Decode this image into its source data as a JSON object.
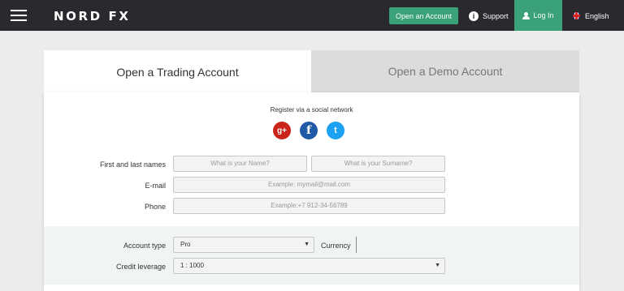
{
  "header": {
    "logo": "NORD FX",
    "open_account_label": "Open an Account",
    "support_label": "Support",
    "support_icon_glyph": "i",
    "login_label": "Log In",
    "language_label": "English"
  },
  "tabs": [
    {
      "label": "Open a Trading Account",
      "active": true
    },
    {
      "label": "Open a Demo Account",
      "active": false
    }
  ],
  "social": {
    "title": "Register via a social network",
    "google_glyph": "g+",
    "facebook_glyph": "f",
    "twitter_glyph": "t"
  },
  "form": {
    "name_label": "First and last names",
    "first_name_placeholder": "What is your Name?",
    "surname_placeholder": "What is your Surname?",
    "email_label": "E-mail",
    "email_placeholder": "Example: mymail@mail.com",
    "phone_label": "Phone",
    "phone_placeholder": "Example:+7 912-34-56789",
    "account_type_label": "Account type",
    "account_type_value": "Pro",
    "currency_label": "Currency",
    "leverage_label": "Credit leverage",
    "leverage_value": "1 : 1000",
    "caret_glyph": "▼"
  },
  "colors": {
    "header_bg": "#2a2a2e",
    "accent_green": "#3aa178",
    "page_bg": "#ececec"
  }
}
